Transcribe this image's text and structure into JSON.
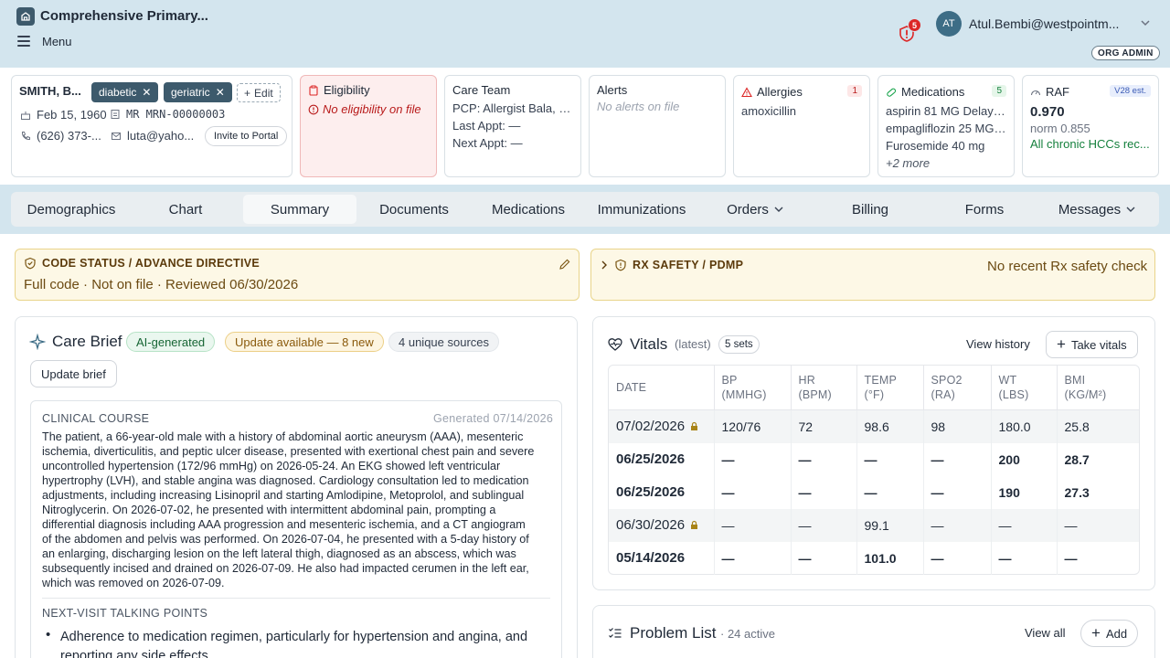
{
  "app": {
    "title": "Comprehensive Primary...",
    "menu_label": "Menu"
  },
  "user": {
    "initials": "AT",
    "email": "Atul.Bembi@westpointm...",
    "alert_count": "5",
    "role_badge": "ORG ADMIN"
  },
  "patient": {
    "name": "SMITH, B...",
    "tags": [
      "diabetic",
      "geriatric"
    ],
    "edit_label": "Edit",
    "dob": "Feb 15, 1960",
    "mrn": "MR MRN-00000003",
    "phone": "(626) 373-...",
    "email": "luta@yaho...",
    "invite_label": "Invite to Portal"
  },
  "cards": {
    "eligibility": {
      "title": "Eligibility",
      "text": "No eligibility on file"
    },
    "care_team": {
      "title": "Care Team",
      "pcp_label": "PCP:",
      "pcp": "Allergist Bala, MD",
      "last": "Last Appt: —",
      "next": "Next Appt: —"
    },
    "alerts": {
      "title": "Alerts",
      "text": "No alerts on file"
    },
    "allergies": {
      "title": "Allergies",
      "count": "1",
      "items": [
        "amoxicillin"
      ]
    },
    "medications": {
      "title": "Medications",
      "count": "5",
      "items": [
        "aspirin 81 MG Delaye...",
        "empagliflozin 25 MG ...",
        "Furosemide 40 mg"
      ],
      "more": "+2 more"
    },
    "raf": {
      "title": "RAF",
      "badge": "V28 est.",
      "score": "0.970",
      "norm": "norm 0.855",
      "note": "All chronic HCCs rec..."
    }
  },
  "tabs": [
    {
      "label": "Demographics"
    },
    {
      "label": "Chart"
    },
    {
      "label": "Summary"
    },
    {
      "label": "Documents"
    },
    {
      "label": "Medications"
    },
    {
      "label": "Immunizations"
    },
    {
      "label": "Orders"
    },
    {
      "label": "Billing"
    },
    {
      "label": "Forms"
    },
    {
      "label": "Messages"
    }
  ],
  "code_status": {
    "title": "CODE STATUS / ADVANCE DIRECTIVE",
    "text": "Full code · Not on file · Reviewed 06/30/2026"
  },
  "rx_safety": {
    "title": "RX SAFETY / PDMP",
    "text": "No recent Rx safety check"
  },
  "care_brief": {
    "title": "Care Brief",
    "ai_badge": "AI-generated",
    "update_badge": "Update available — 8 new",
    "sources_badge": "4 unique sources",
    "update_button": "Update brief",
    "clinical_course_label": "CLINICAL COURSE",
    "generated": "Generated 07/14/2026",
    "clinical_course_lines": [
      "The patient, a 66-year-old male with a history of abdominal aortic aneurysm (AAA), mesenteric",
      "ischemia, diverticulitis, and peptic ulcer disease, presented with exertional chest pain and severe",
      "uncontrolled hypertension (172/96 mmHg) on 2026-05-24. An EKG showed left ventricular",
      "hypertrophy (LVH), and stable angina was diagnosed. Cardiology consultation led to medication",
      "adjustments, including increasing Lisinopril and starting Amlodipine, Metoprolol, and sublingual",
      "Nitroglycerin. On 2026-07-02, he presented with intermittent abdominal pain, prompting a",
      "differential diagnosis including AAA progression and mesenteric ischemia, and a CT angiogram",
      "of the abdomen and pelvis was performed. On 2026-07-04, he presented with a 5-day history of",
      "an enlarging, discharging lesion on the left lateral thigh, diagnosed as an abscess, which was",
      "subsequently incised and drained on 2026-07-09. He also had impacted cerumen in the left ear,",
      "which was removed on 2026-07-09."
    ],
    "talking_points_label": "NEXT-VISIT TALKING POINTS",
    "talking_point_1a": "Adherence to medication regimen, particularly for hypertension and angina, and",
    "talking_point_1b": "reporting any side effects."
  },
  "vitals": {
    "title": "Vitals",
    "subtitle": "(latest)",
    "sets": "5 sets",
    "view_history": "View history",
    "take_vitals": "Take vitals",
    "headers": [
      [
        "DATE",
        ""
      ],
      [
        "BP",
        "(MMHG)"
      ],
      [
        "HR",
        "(BPM)"
      ],
      [
        "TEMP",
        "(°F)"
      ],
      [
        "SPO2",
        "(RA)"
      ],
      [
        "WT",
        "(LBS)"
      ],
      [
        "BMI",
        "(KG/M²)"
      ]
    ],
    "rows": [
      {
        "date": "07/02/2026",
        "locked": true,
        "bp": "120/76",
        "hr": "72",
        "temp": "98.6",
        "spo2": "98",
        "wt": "180.0",
        "bmi": "25.8"
      },
      {
        "date": "06/25/2026",
        "locked": false,
        "bp": "—",
        "hr": "—",
        "temp": "—",
        "spo2": "—",
        "wt": "200",
        "bmi": "28.7"
      },
      {
        "date": "06/25/2026",
        "locked": false,
        "bp": "—",
        "hr": "—",
        "temp": "—",
        "spo2": "—",
        "wt": "190",
        "bmi": "27.3"
      },
      {
        "date": "06/30/2026",
        "locked": true,
        "bp": "—",
        "hr": "—",
        "temp": "99.1",
        "spo2": "—",
        "wt": "—",
        "bmi": "—"
      },
      {
        "date": "05/14/2026",
        "locked": false,
        "bp": "—",
        "hr": "—",
        "temp": "101.0",
        "spo2": "—",
        "wt": "—",
        "bmi": "—"
      }
    ]
  },
  "problem_list": {
    "title": "Problem List",
    "count": "· 24 active",
    "view_all": "View all",
    "add": "Add"
  },
  "colors": {
    "header_bg": "#d3e5ee",
    "tag_bg": "#3d5a6c",
    "danger": "#dc2626",
    "warning_bg": "#fdf8e6",
    "success": "#15803d"
  }
}
